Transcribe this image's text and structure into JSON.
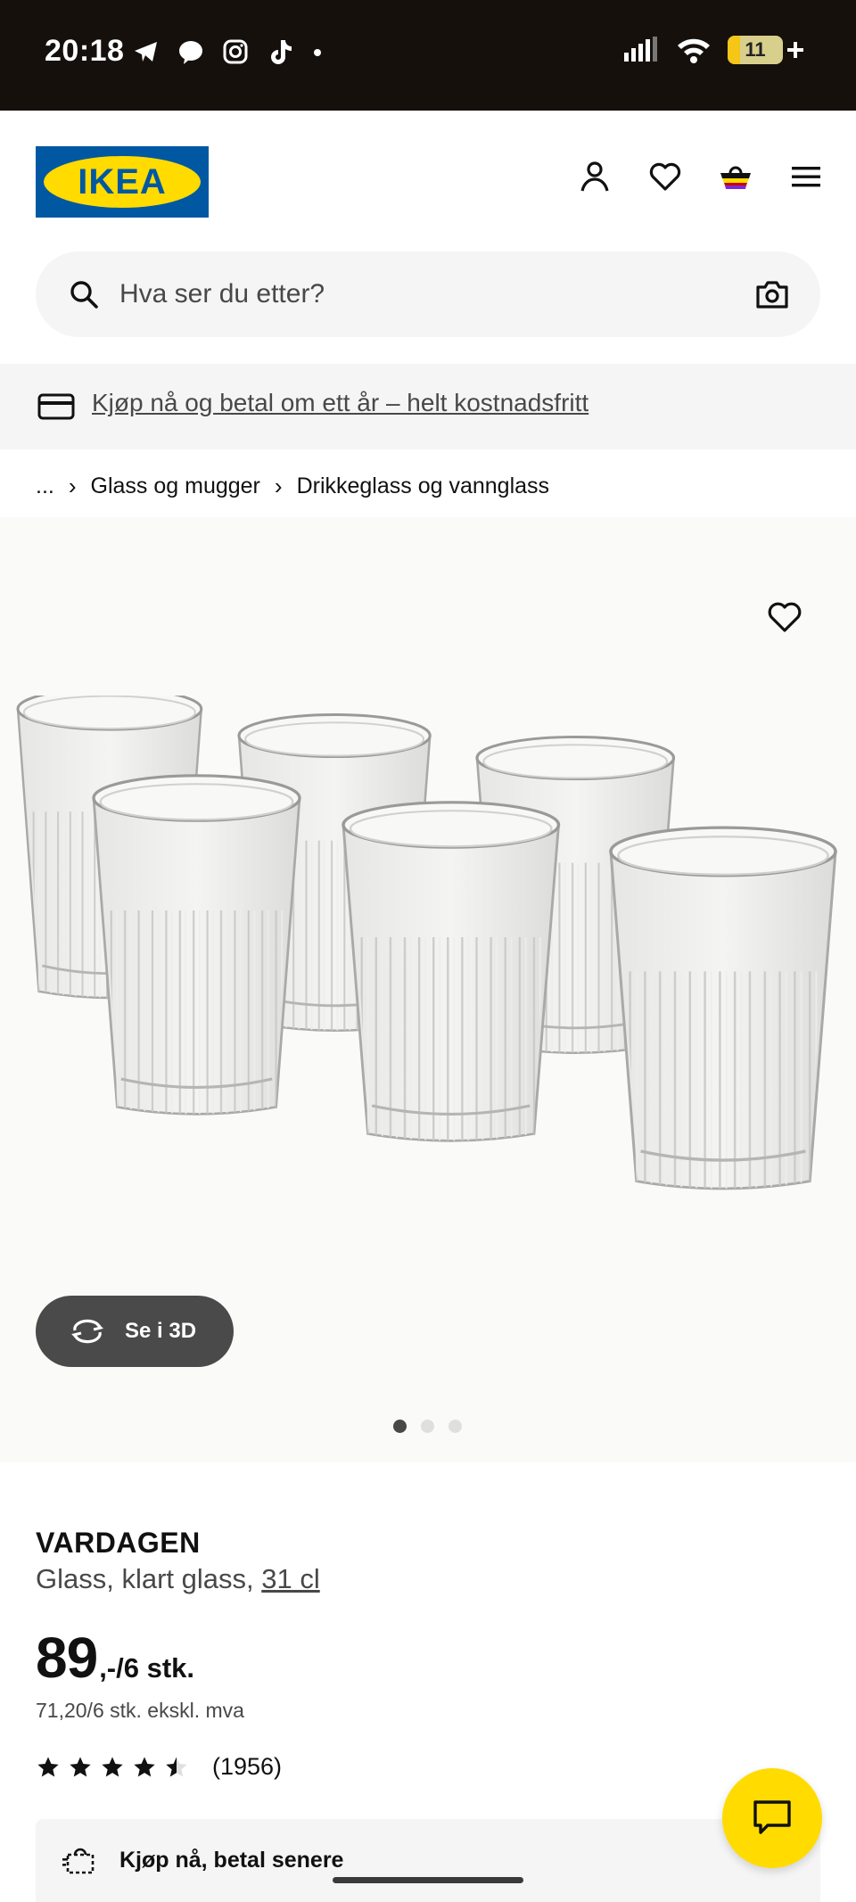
{
  "status_bar": {
    "time": "20:18",
    "app_icons": [
      "telegram-icon",
      "messenger-icon",
      "instagram-icon",
      "tiktok-icon",
      "dot-icon"
    ],
    "battery": "11"
  },
  "header": {
    "logo_text": "IKEA",
    "icons": [
      "account-icon",
      "favourites-heart-icon",
      "shopping-basket-icon",
      "hamburger-menu-icon"
    ]
  },
  "search": {
    "placeholder": "Hva ser du etter?"
  },
  "promo": {
    "text": "Kjøp nå og betal om ett år – helt kostnadsfritt"
  },
  "breadcrumb": {
    "items": [
      "...",
      "Glass og mugger",
      "Drikkeglass og vannglass"
    ]
  },
  "gallery": {
    "view_3d_label": "Se i 3D",
    "image_count": 3,
    "active_index": 0
  },
  "product": {
    "name": "VARDAGEN",
    "description": "Glass, klart glass, ",
    "size": "31 cl",
    "price_main": "89",
    "price_suffix": ",-/6 stk.",
    "price_ex_vat": "71,20/6 stk. ekskl. mva",
    "rating": 4.5,
    "rating_max": 5,
    "review_count": "(1956)"
  },
  "buy_later": {
    "label": "Kjøp nå, betal senere"
  },
  "colors": {
    "ikea_blue": "#0058a3",
    "ikea_yellow": "#ffdb00",
    "status_bar_bg": "#15100c"
  }
}
